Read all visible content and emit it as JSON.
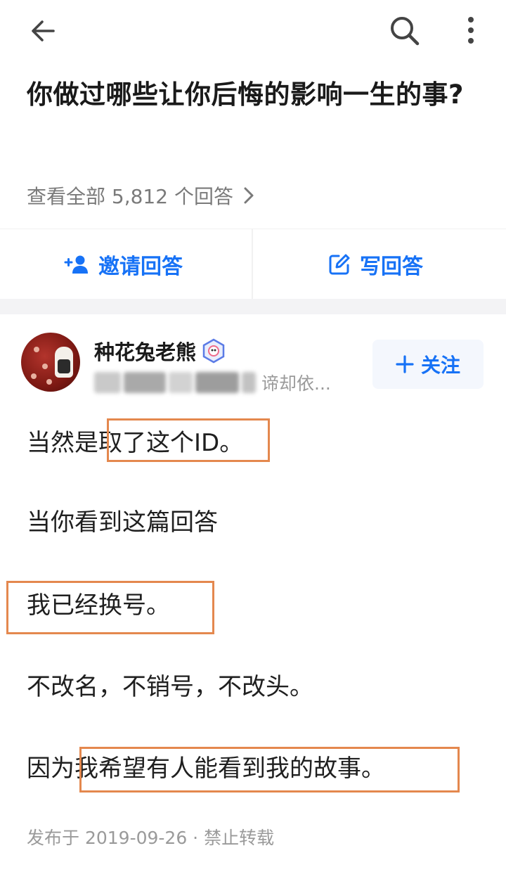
{
  "topbar": {
    "back_icon": "back-arrow-icon",
    "search_icon": "search-icon",
    "more_icon": "more-vertical-icon"
  },
  "question": {
    "title": "你做过哪些让你后悔的影响一生的事?",
    "view_all": "查看全部 5,812 个回答"
  },
  "actions": {
    "invite_label": "邀请回答",
    "write_label": "写回答"
  },
  "author": {
    "name": "种花兔老熊",
    "bio_visible": "谛却依..."
  },
  "follow_label": "关注",
  "answer": {
    "p1_pre": "当然是",
    "p1_hl": "取了这个ID。",
    "p2": "当你看到这篇回答",
    "p3": "我已经换号。",
    "p4": "不改名，不销号，不改头。",
    "p5_pre": "因为",
    "p5_hl": "我希望有人能看到我的故事。"
  },
  "meta": "发布于 2019-09-26 · 禁止转载",
  "colors": {
    "accent": "#1772f6",
    "highlight_box": "#e4884e",
    "muted": "#9a9a9a"
  }
}
